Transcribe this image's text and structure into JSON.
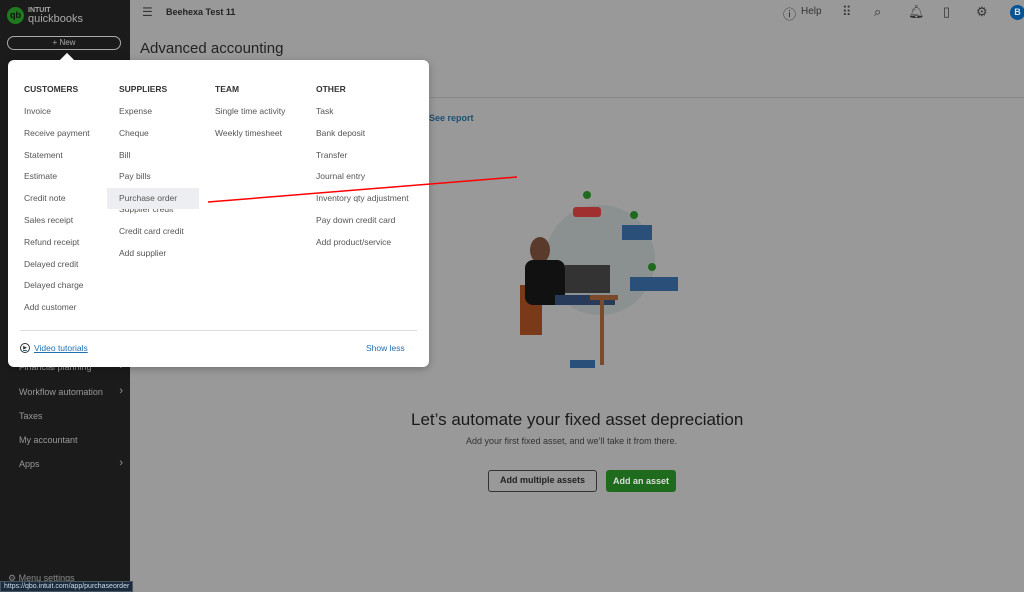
{
  "sidebar": {
    "logo_brand": "INTUIT",
    "logo_product": "quickbooks",
    "new_label": "+ New",
    "items": [
      {
        "label": "Financial planning",
        "chevron": true
      },
      {
        "label": "Workflow automation",
        "chevron": true
      },
      {
        "label": "Taxes"
      },
      {
        "label": "My accountant"
      },
      {
        "label": "Apps",
        "chevron": true
      }
    ],
    "menu_settings": "Menu settings"
  },
  "status_url": "https://qbo.intuit.com/app/purchaseorder",
  "topbar": {
    "company": "Beehexa Test 11",
    "help": "Help",
    "avatar": "B",
    "icons": [
      "menu-collapse-icon",
      "help-icon",
      "apps-grid-icon",
      "search-icon",
      "bell-icon",
      "clipboard-icon",
      "gear-icon"
    ]
  },
  "page": {
    "title": "Advanced accounting",
    "see_report": "See report",
    "cta_title": "Let’s automate your fixed asset depreciation",
    "cta_sub": "Add your first fixed asset, and we’ll take it from there.",
    "btn_multi": "Add multiple assets",
    "btn_add": "Add an asset"
  },
  "new_menu": {
    "columns": [
      {
        "heading": "CUSTOMERS",
        "items": [
          "Invoice",
          "Receive payment",
          "Statement",
          "Estimate",
          "Credit note",
          "Sales receipt",
          "Refund receipt",
          "Delayed credit",
          "Delayed charge",
          "Add customer"
        ]
      },
      {
        "heading": "SUPPLIERS",
        "items": [
          "Expense",
          "Cheque",
          "Bill",
          "Pay bills",
          "Purchase order",
          "Supplier credit",
          "Credit card credit",
          "Add supplier"
        ]
      },
      {
        "heading": "TEAM",
        "items": [
          "Single time activity",
          "Weekly timesheet"
        ]
      },
      {
        "heading": "OTHER",
        "items": [
          "Task",
          "Bank deposit",
          "Transfer",
          "Journal entry",
          "Inventory qty adjustment",
          "Pay down credit card",
          "Add product/service"
        ]
      }
    ],
    "highlighted": "Purchase order",
    "video_tutorials": "Video tutorials",
    "show_less": "Show less"
  },
  "colors": {
    "brand_green": "#2ca01c",
    "link_blue": "#0077c5",
    "annotation_red": "#ff0000"
  }
}
